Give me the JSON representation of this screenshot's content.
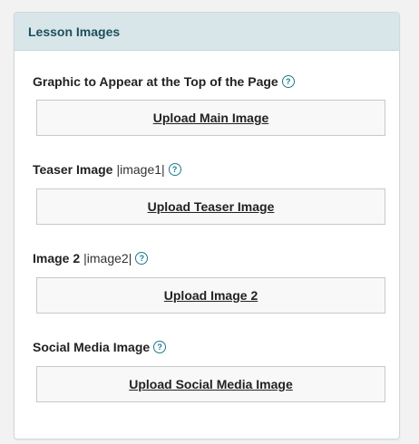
{
  "panel": {
    "title": "Lesson Images"
  },
  "fields": [
    {
      "label": "Graphic to Appear at the Top of the Page",
      "token": "",
      "help_icon": "question-circle-icon",
      "button_label": "Upload Main Image"
    },
    {
      "label": "Teaser Image",
      "token": "|image1|",
      "help_icon": "question-circle-icon",
      "button_label": "Upload Teaser Image"
    },
    {
      "label": "Image 2",
      "token": "|image2|",
      "help_icon": "question-circle-icon",
      "button_label": "Upload Image 2"
    },
    {
      "label": "Social Media Image",
      "token": "",
      "help_icon": "question-circle-icon",
      "button_label": "Upload Social Media Image"
    }
  ],
  "colors": {
    "header_bg": "#d8e6ea",
    "header_text": "#1d4f5c",
    "help_icon": "#1a7a8c"
  }
}
